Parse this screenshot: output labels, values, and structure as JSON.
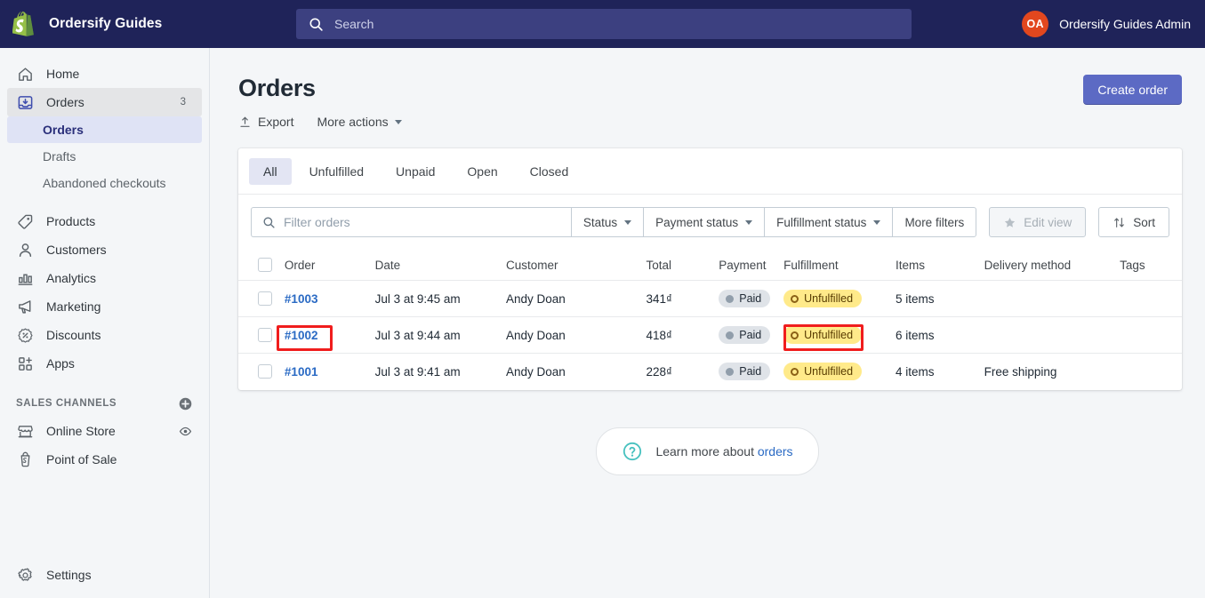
{
  "topbar": {
    "store_name": "Ordersify Guides",
    "logo_icon": "shopify-bag-icon",
    "search": {
      "placeholder": "Search",
      "icon": "search-icon"
    },
    "account": {
      "initials": "OA",
      "name": "Ordersify Guides Admin"
    }
  },
  "sidebar": {
    "items": [
      {
        "label": "Home",
        "icon": "home-icon",
        "badge": ""
      },
      {
        "label": "Orders",
        "icon": "orders-inbox-icon",
        "badge": "3"
      },
      {
        "label": "Products",
        "icon": "products-tag-icon",
        "badge": ""
      },
      {
        "label": "Customers",
        "icon": "customers-person-icon",
        "badge": ""
      },
      {
        "label": "Analytics",
        "icon": "analytics-bars-icon",
        "badge": ""
      },
      {
        "label": "Marketing",
        "icon": "marketing-megaphone-icon",
        "badge": ""
      },
      {
        "label": "Discounts",
        "icon": "discounts-percent-icon",
        "badge": ""
      },
      {
        "label": "Apps",
        "icon": "apps-grid-plus-icon",
        "badge": ""
      }
    ],
    "orders_subitems": [
      {
        "label": "Orders"
      },
      {
        "label": "Drafts"
      },
      {
        "label": "Abandoned checkouts"
      }
    ],
    "sales_channels": {
      "title": "SALES CHANNELS",
      "add_icon": "plus-circle-icon",
      "items": [
        {
          "label": "Online Store",
          "icon": "storefront-icon",
          "trailing_icon": "eye-icon"
        },
        {
          "label": "Point of Sale",
          "icon": "pos-icon",
          "trailing_icon": ""
        }
      ]
    },
    "settings": {
      "label": "Settings",
      "icon": "gear-icon"
    }
  },
  "page": {
    "title": "Orders",
    "export_label": "Export",
    "export_icon": "upload-icon",
    "more_actions_label": "More actions",
    "create_order_label": "Create order"
  },
  "tabs": [
    {
      "label": "All",
      "active": true
    },
    {
      "label": "Unfulfilled",
      "active": false
    },
    {
      "label": "Unpaid",
      "active": false
    },
    {
      "label": "Open",
      "active": false
    },
    {
      "label": "Closed",
      "active": false
    }
  ],
  "filters": {
    "search_placeholder": "Filter orders",
    "search_icon": "search-icon",
    "status_label": "Status",
    "payment_status_label": "Payment status",
    "fulfillment_status_label": "Fulfillment status",
    "more_filters_label": "More filters",
    "edit_view_label": "Edit view",
    "edit_view_icon": "star-icon",
    "sort_label": "Sort",
    "sort_icon": "sort-arrows-icon"
  },
  "table": {
    "columns": [
      "Order",
      "Date",
      "Customer",
      "Total",
      "Payment",
      "Fulfillment",
      "Items",
      "Delivery method",
      "Tags"
    ],
    "rows": [
      {
        "order": "#1003",
        "date": "Jul 3 at 9:45 am",
        "customer": "Andy Doan",
        "total": "341₫",
        "payment": "Paid",
        "fulfillment": "Unfulfilled",
        "items": "5 items",
        "delivery": "",
        "tags": ""
      },
      {
        "order": "#1002",
        "date": "Jul 3 at 9:44 am",
        "customer": "Andy Doan",
        "total": "418₫",
        "payment": "Paid",
        "fulfillment": "Unfulfilled",
        "items": "6 items",
        "delivery": "",
        "tags": ""
      },
      {
        "order": "#1001",
        "date": "Jul 3 at 9:41 am",
        "customer": "Andy Doan",
        "total": "228₫",
        "payment": "Paid",
        "fulfillment": "Unfulfilled",
        "items": "4 items",
        "delivery": "Free shipping",
        "tags": ""
      }
    ]
  },
  "help": {
    "icon": "question-circle-icon",
    "text": "Learn more about",
    "link": "orders"
  },
  "colors": {
    "topbar_bg": "#1f2359",
    "accent_primary": "#5c6ac4",
    "link_blue": "#2a6ac4",
    "badge_unfulfilled_bg": "#ffea8a",
    "badge_paid_bg": "#dfe3e8",
    "annotation_red": "#f01d1d",
    "avatar_bg": "#e2471e",
    "help_icon_teal": "#47c1bf"
  }
}
